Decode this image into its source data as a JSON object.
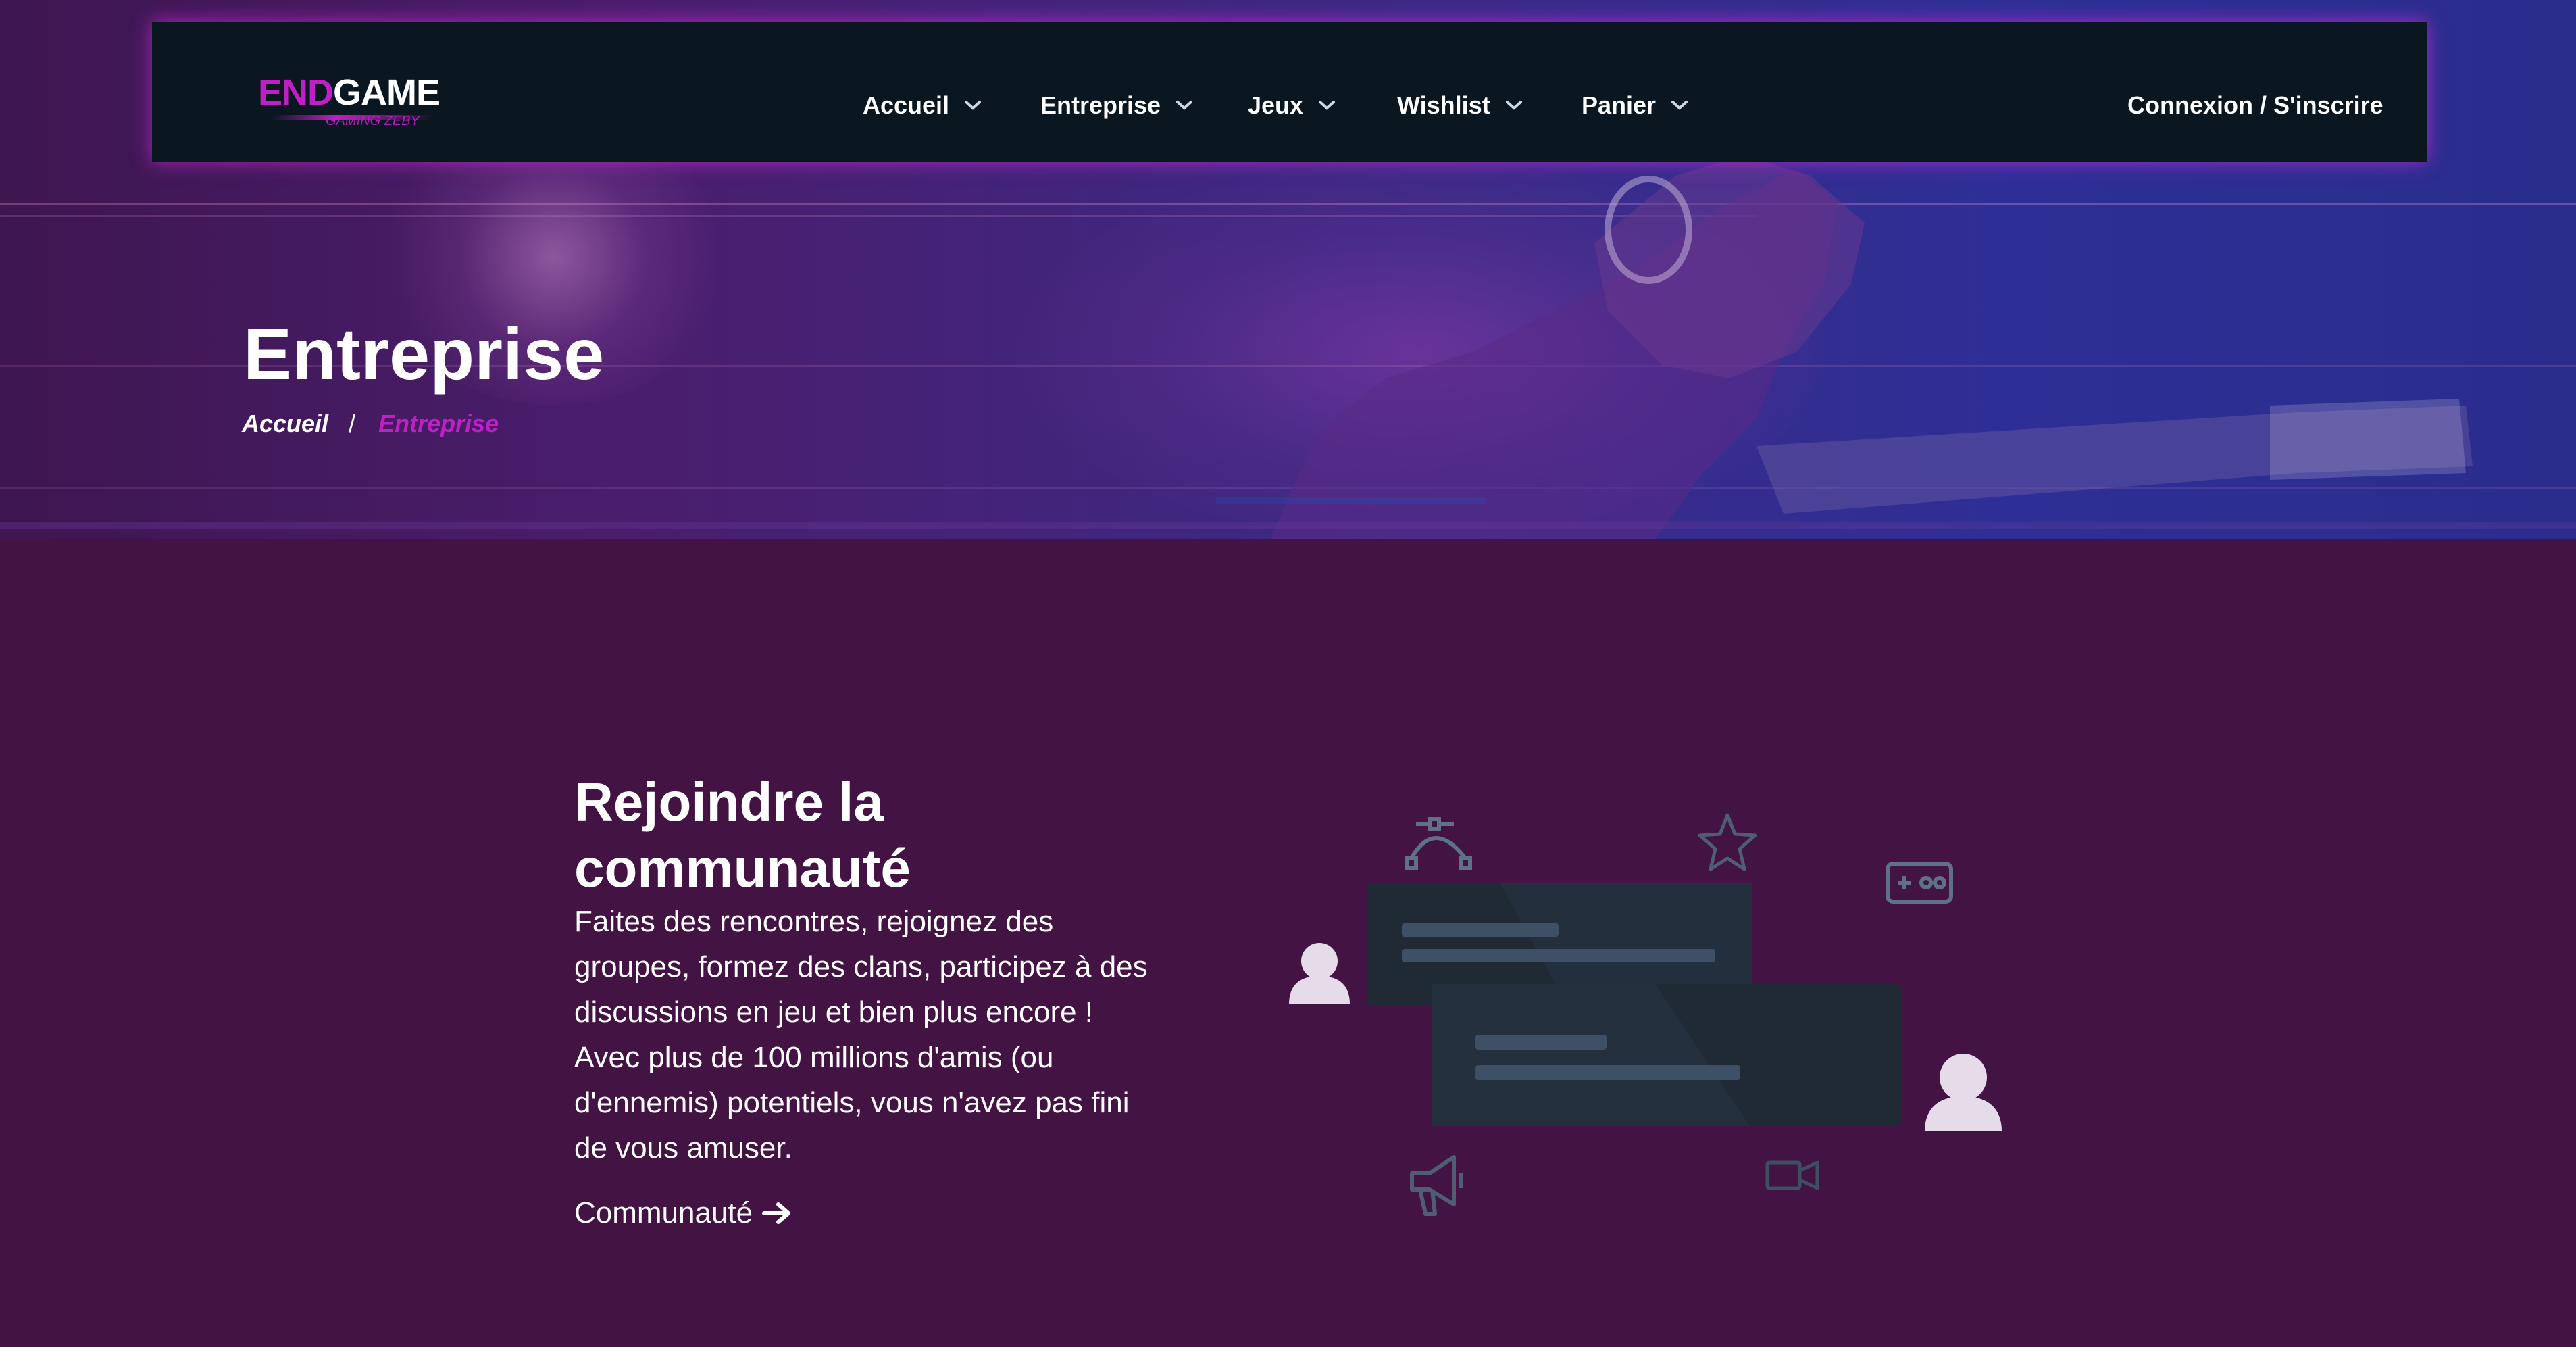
{
  "brand": {
    "logo_primary": "END",
    "logo_secondary": "GAME",
    "logo_tagline_bold": "GAMING",
    "logo_tagline_light": "ZEBY",
    "accent_color": "#c11fc6",
    "nav_background": "#0a1620",
    "page_background": "#431343"
  },
  "nav": {
    "items": [
      {
        "label": "Accueil",
        "icon": "chevron-down-icon"
      },
      {
        "label": "Entreprise",
        "icon": "chevron-down-icon"
      },
      {
        "label": "Jeux",
        "icon": "chevron-down-icon"
      },
      {
        "label": "Wishlist",
        "icon": "chevron-down-icon"
      },
      {
        "label": "Panier",
        "icon": "chevron-down-icon"
      }
    ],
    "login_label": "Connexion / S'inscrire"
  },
  "header": {
    "title": "Entreprise",
    "breadcrumb": {
      "home": "Accueil",
      "separator": "/",
      "current": "Entreprise"
    }
  },
  "community": {
    "title": "Rejoindre la communauté",
    "body": "Faites des rencontres, rejoignez des groupes, formez des clans, participez à des discussions en jeu et bien plus encore ! Avec plus de 100 millions d'amis (ou d'ennemis) potentiels, vous n'avez pas fini de vous amuser.",
    "link_label": "Communauté",
    "link_icon": "arrow-right-icon"
  },
  "illustration": {
    "icons": [
      "bezier-icon",
      "star-icon",
      "gamepad-icon",
      "user-icon",
      "megaphone-icon",
      "video-camera-icon"
    ]
  }
}
